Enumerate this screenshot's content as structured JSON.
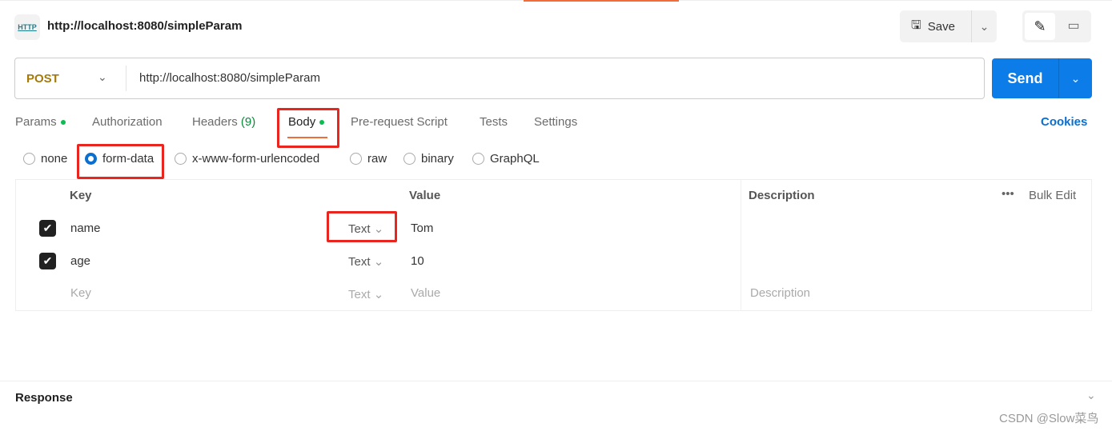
{
  "header": {
    "icon": "http-icon",
    "title": "http://localhost:8080/simpleParam",
    "save_label": "Save"
  },
  "request": {
    "method": "POST",
    "url": "http://localhost:8080/simpleParam",
    "send_label": "Send"
  },
  "tabs": [
    {
      "label": "Params",
      "dot": true
    },
    {
      "label": "Authorization"
    },
    {
      "label": "Headers",
      "count": "(9)"
    },
    {
      "label": "Body",
      "dot": true,
      "active": true
    },
    {
      "label": "Pre-request Script"
    },
    {
      "label": "Tests"
    },
    {
      "label": "Settings"
    }
  ],
  "cookies_label": "Cookies",
  "body_types": [
    {
      "label": "none"
    },
    {
      "label": "form-data",
      "selected": true
    },
    {
      "label": "x-www-form-urlencoded"
    },
    {
      "label": "raw"
    },
    {
      "label": "binary"
    },
    {
      "label": "GraphQL"
    }
  ],
  "table": {
    "headers": {
      "key": "Key",
      "value": "Value",
      "description": "Description",
      "bulk_edit": "Bulk Edit"
    },
    "rows": [
      {
        "checked": true,
        "key": "name",
        "type": "Text",
        "value": "Tom"
      },
      {
        "checked": true,
        "key": "age",
        "type": "Text",
        "value": "10"
      }
    ],
    "placeholder": {
      "key": "Key",
      "type": "Text",
      "value": "Value",
      "description": "Description"
    }
  },
  "response": {
    "title": "Response"
  },
  "watermark": "CSDN @Slow菜鸟",
  "colors": {
    "accent": "#0b7ce8",
    "method": "#a57a0c",
    "highlight": "#e8251f",
    "active_tab": "#f26b3a"
  }
}
